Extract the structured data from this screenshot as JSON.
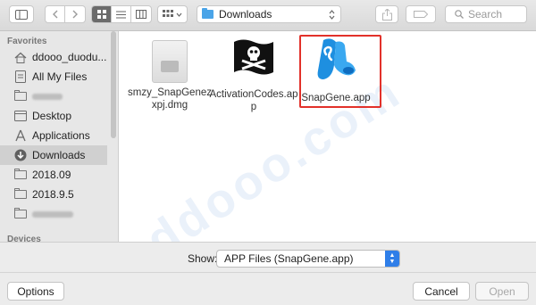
{
  "toolbar": {
    "path_label": "Downloads",
    "search_placeholder": "Search"
  },
  "sidebar": {
    "favorites_header": "Favorites",
    "devices_header": "Devices",
    "items": [
      {
        "label": "ddooo_duodu...",
        "icon": "home-icon"
      },
      {
        "label": "All My Files",
        "icon": "all-files-icon"
      },
      {
        "label": "",
        "icon": "folder-icon"
      },
      {
        "label": "Desktop",
        "icon": "desktop-icon"
      },
      {
        "label": "Applications",
        "icon": "applications-icon"
      },
      {
        "label": "Downloads",
        "icon": "downloads-icon"
      },
      {
        "label": "2018.09",
        "icon": "folder-icon"
      },
      {
        "label": "2018.9.5",
        "icon": "folder-icon"
      },
      {
        "label": "",
        "icon": "folder-icon"
      }
    ]
  },
  "files": [
    {
      "name": "smzy_SnapGenezxpj.dmg",
      "icon": "disk-image-icon"
    },
    {
      "name": "ActivationCodes.app",
      "icon": "pirate-flag-icon"
    },
    {
      "name": "SnapGene.app",
      "icon": "snapgene-icon"
    }
  ],
  "show": {
    "label": "Show:",
    "value": "APP Files (SnapGene.app)"
  },
  "footer": {
    "options_label": "Options",
    "cancel_label": "Cancel",
    "open_label": "Open"
  },
  "colors": {
    "selection_outline": "#e2312a",
    "accent": "#2f7ee8",
    "folder_blue": "#4aa4e8"
  }
}
